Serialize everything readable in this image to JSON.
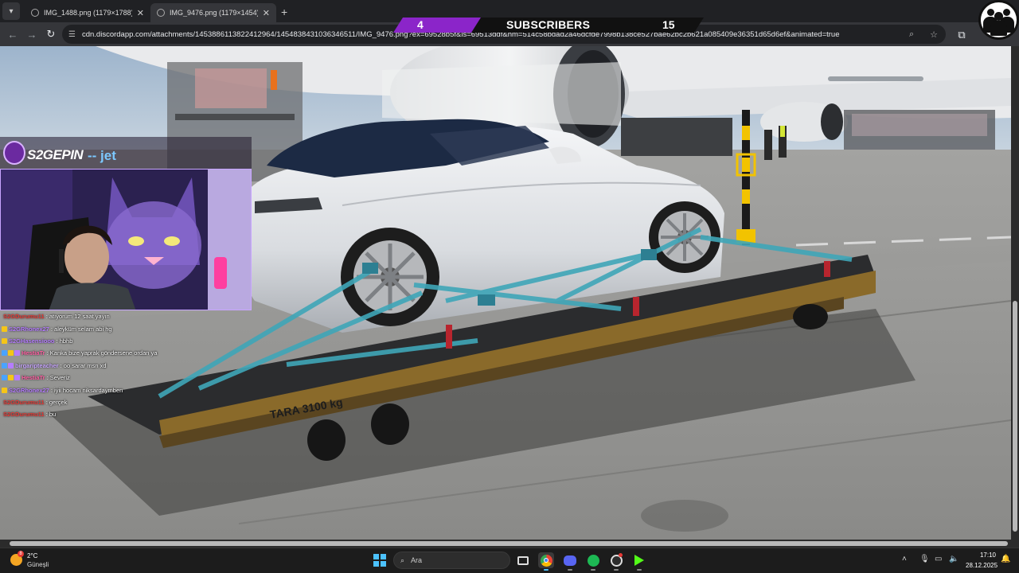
{
  "browser": {
    "tabs": [
      {
        "title": "IMG_1488.png (1179×1788)",
        "active": false
      },
      {
        "title": "IMG_9476.png (1179×1454)",
        "active": true
      }
    ],
    "url": "cdn.discordapp.com/attachments/1453886113822412964/1454838431036346511/IMG_9476.png?ex=69528b5f&is=69513ddf&hm=514c58bdad2a46dcfde7998b138ce527bae62bc2b621a085409e36351d65d6ef&animated=true"
  },
  "overlay": {
    "subscribers_left": "4",
    "subscribers_label": "SUBSCRIBERS",
    "subscribers_right": "15",
    "brand_name": "S2GEPIN",
    "sponsor": "-- jet"
  },
  "chat": [
    {
      "user": "S2GDurumu11",
      "text": ": atıyorum 12 saat yayın",
      "color": "#e53935",
      "badges": []
    },
    {
      "user": "S2GRhonex27",
      "text": ": aleyküm selam abi hg",
      "color": "#b57cff",
      "badges": [
        "#f5c518"
      ]
    },
    {
      "user": "S2GHasensiooo",
      "text": ": hbhb",
      "color": "#b57cff",
      "badges": [
        "#f5c518"
      ]
    },
    {
      "user": "HestiaTr",
      "text": ": Kanka bize yaprak göndersene ordan ya",
      "color": "#ff5fa2",
      "badges": [
        "#4aa3ff",
        "#f5c518",
        "#b57cff"
      ]
    },
    {
      "user": "birgaripteacher",
      "text": ": oo sarar msn xd",
      "color": "#c9a8ff",
      "badges": [
        "#4aa3ff",
        "#b57cff"
      ]
    },
    {
      "user": "HestiaTr",
      "text": ": Severiz",
      "color": "#ff5fa2",
      "badges": [
        "#4aa3ff",
        "#f5c518",
        "#b57cff"
      ]
    },
    {
      "user": "S2GRhonex27",
      "text": ": iyii hocam niksardaymben",
      "color": "#b57cff",
      "badges": [
        "#f5c518"
      ]
    },
    {
      "user": "S2GDurumu11",
      "text": ": gerçek",
      "color": "#e53935",
      "badges": []
    },
    {
      "user": "S2GDurumu11",
      "text": ": bu",
      "color": "#e53935",
      "badges": []
    }
  ],
  "photo": {
    "dolly_label": "TARA 3100 kg"
  },
  "taskbar": {
    "weather_temp": "2°C",
    "weather_desc": "Güneşli",
    "weather_badge": "8",
    "search_placeholder": "Ara",
    "time": "17:10",
    "date": "28.12.2025"
  },
  "colors": {
    "accent_purple": "#8b25c9",
    "taskbar": "#1c1c1c",
    "chrome_dark": "#202124"
  }
}
